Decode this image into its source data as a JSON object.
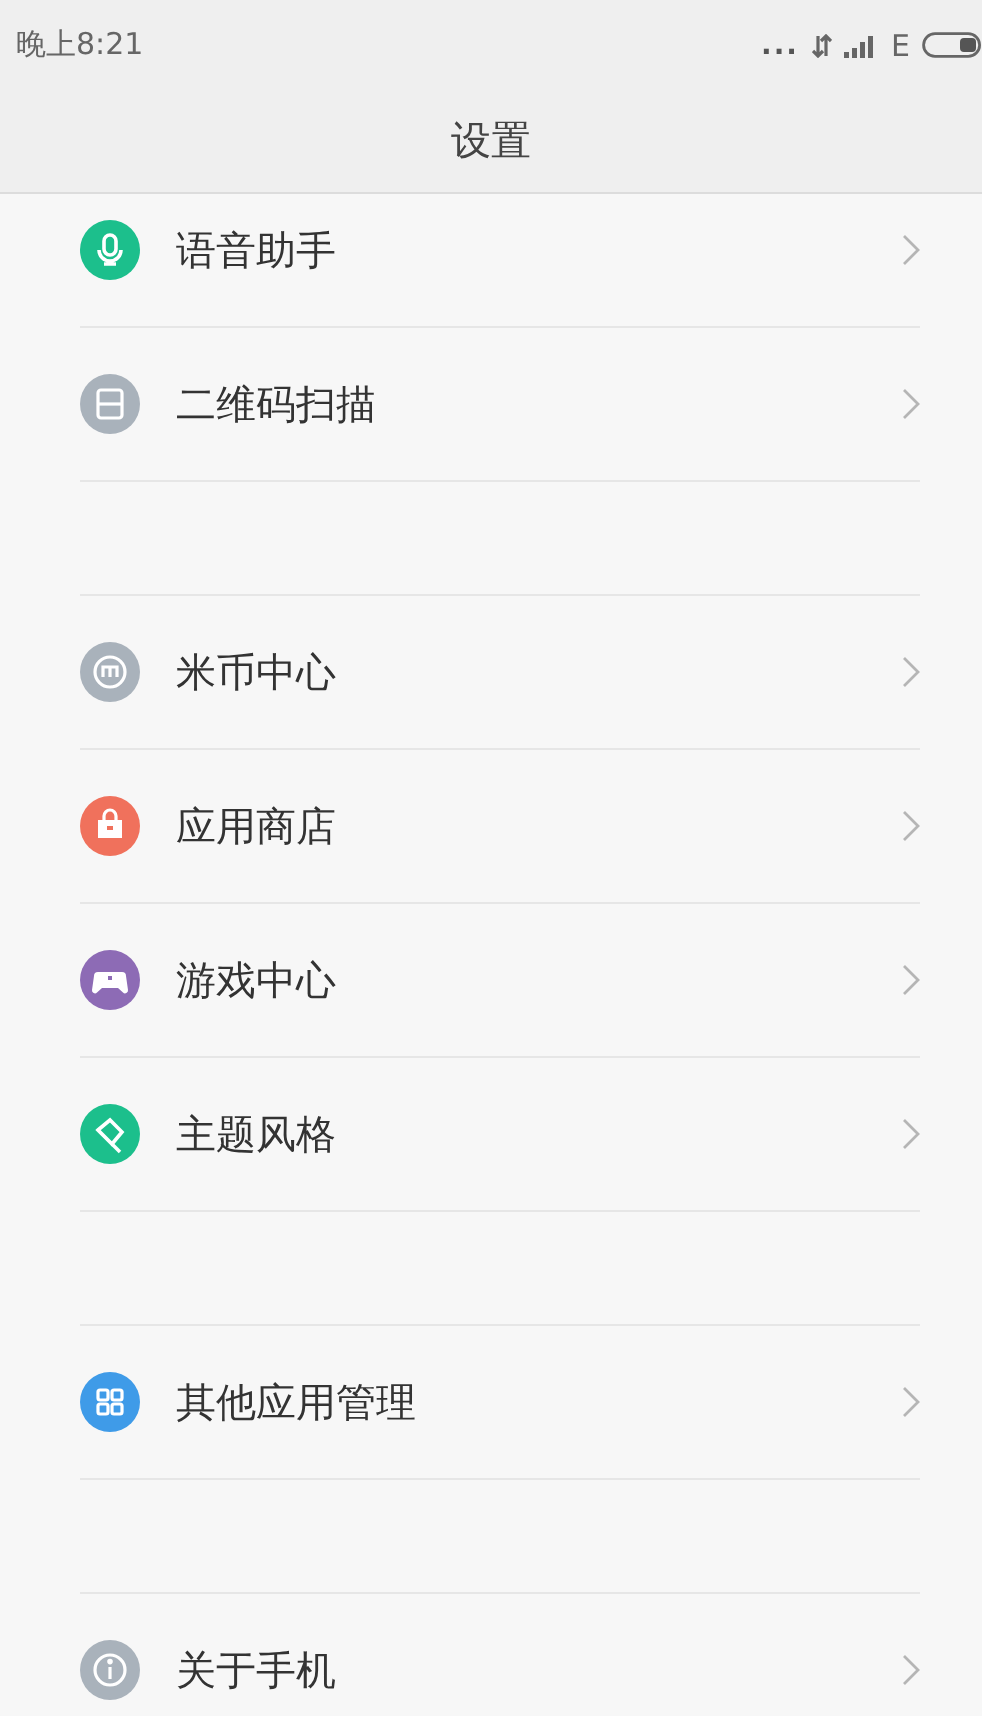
{
  "status_bar": {
    "time": "晚上8:21",
    "dots": "...",
    "network": "E"
  },
  "title": "设置",
  "groups": [
    {
      "items": [
        {
          "label": "语音助手",
          "kind": "mic",
          "color": "#1cbf8c"
        },
        {
          "label": "二维码扫描",
          "kind": "scan",
          "color": "#a9b2bb"
        }
      ]
    },
    {
      "items": [
        {
          "label": "米币中心",
          "kind": "coin",
          "color": "#a9b2bb"
        },
        {
          "label": "应用商店",
          "kind": "bag",
          "color": "#f0715c"
        },
        {
          "label": "游戏中心",
          "kind": "gamepad",
          "color": "#8d6bb5"
        },
        {
          "label": "主题风格",
          "kind": "brush",
          "color": "#1cbf8c"
        }
      ]
    },
    {
      "items": [
        {
          "label": "其他应用管理",
          "kind": "grid",
          "color": "#3f9be8"
        }
      ]
    },
    {
      "items": [
        {
          "label": "关于手机",
          "kind": "info",
          "color": "#a9b2bb"
        }
      ]
    }
  ]
}
